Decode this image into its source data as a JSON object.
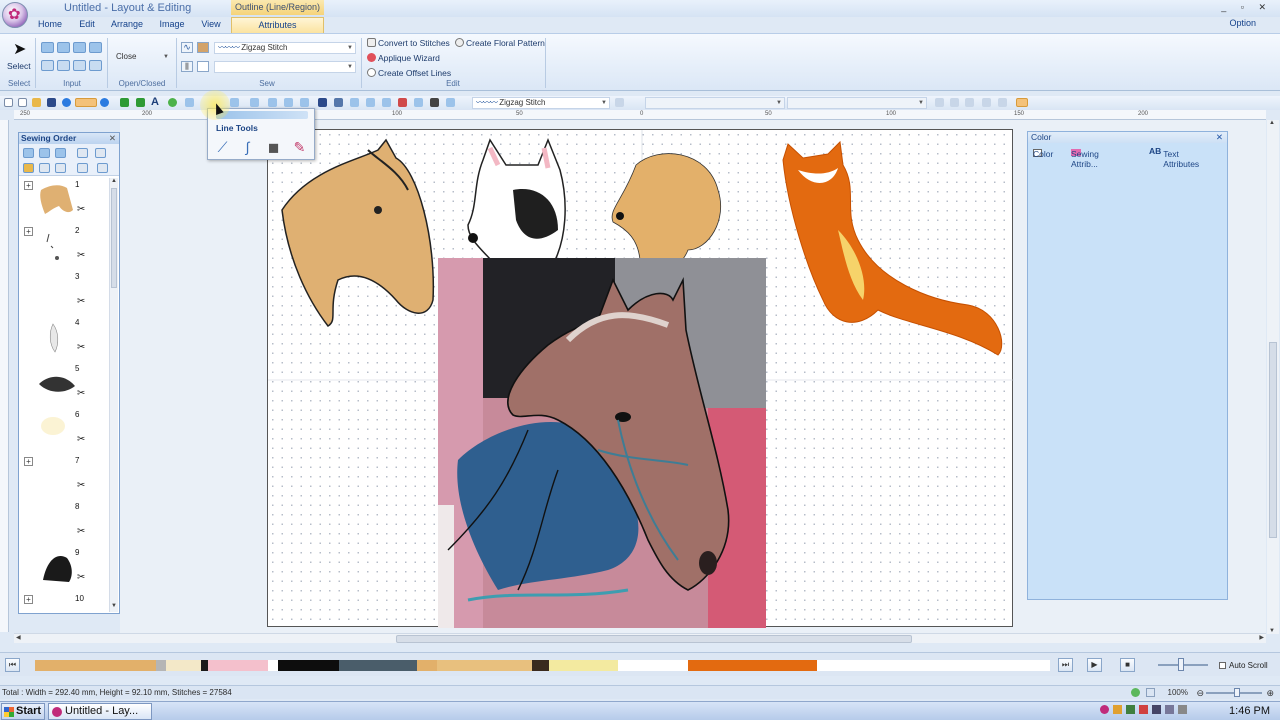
{
  "window": {
    "title": "Untitled - Layout & Editing",
    "context_group": "Outline (Line/Region)",
    "controls": "_ ▫ ✕"
  },
  "tabs": [
    {
      "label": "Home"
    },
    {
      "label": "Edit"
    },
    {
      "label": "Arrange"
    },
    {
      "label": "Image"
    },
    {
      "label": "View"
    },
    {
      "label": "Attributes"
    }
  ],
  "option_label": "Option",
  "ribbon": {
    "select_label": "Select",
    "groups": [
      "Select",
      "Input",
      "Open/Closed",
      "Sew",
      "Edit"
    ],
    "open_closed_value": "Close",
    "sew_value": "Zigzag Stitch",
    "edit_buttons": [
      "Convert to Stitches",
      "Create Floral Pattern",
      "Applique Wizard",
      "Create Offset Lines"
    ]
  },
  "toolbar": {
    "stitch_value": "Zigzag Stitch"
  },
  "ruler_labels": [
    "250",
    "200",
    "150",
    "100",
    "50",
    "0",
    "50",
    "100",
    "150",
    "200"
  ],
  "flyout": {
    "title": "Line Tools",
    "tools": [
      "straight-line-icon",
      "curve-line-icon",
      "shape-stamp-icon",
      "freehand-icon"
    ]
  },
  "sewing_order": {
    "title": "Sewing Order",
    "items": [
      {
        "num": "1",
        "expand": "+"
      },
      {
        "num": "2",
        "expand": "+"
      },
      {
        "num": "3",
        "expand": ""
      },
      {
        "num": "4",
        "expand": ""
      },
      {
        "num": "5",
        "expand": ""
      },
      {
        "num": "6",
        "expand": ""
      },
      {
        "num": "7",
        "expand": "+"
      },
      {
        "num": "8",
        "expand": ""
      },
      {
        "num": "9",
        "expand": ""
      },
      {
        "num": "10",
        "expand": "+"
      }
    ]
  },
  "color_panel": {
    "title": "Color",
    "tabs": [
      "Color",
      "Sewing Attrib...",
      "Text Attributes"
    ]
  },
  "timeline": {
    "auto_scroll_label": "Auto Scroll",
    "colors": [
      "#e2b06a",
      "#b5b5b5",
      "#f3e8c8",
      "#1a1a1a",
      "#f4c0cc",
      "#ffffff",
      "#0d0d0d",
      "#4a5d6a",
      "#e2b06a",
      "#e8c07e",
      "#3a2a1e",
      "#f3eaa0",
      "#ffffff",
      "#e36a10",
      "#ffffff"
    ]
  },
  "status": {
    "text": "Total : Width = 292.40 mm, Height = 92.10 mm, Stitches = 27584",
    "zoom": "100%"
  },
  "taskbar": {
    "start_label": "Start",
    "task_label": "Untitled - Lay...",
    "clock": "1:46 PM"
  }
}
